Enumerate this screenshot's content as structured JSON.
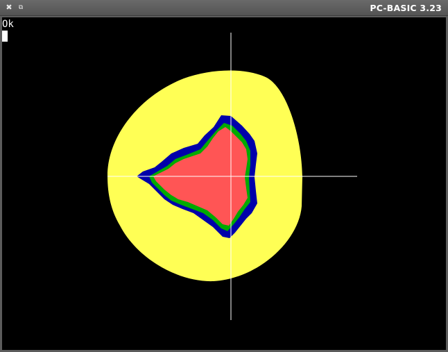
{
  "window": {
    "title": "PC-BASIC 3.23",
    "close_glyph": "✖",
    "restore_glyph": "⧉"
  },
  "screen": {
    "prompt": "Ok"
  },
  "colors": {
    "outer_ring": "#ffff55",
    "band_blue": "#0000aa",
    "band_green": "#00aa00",
    "set_red": "#ff5555",
    "axes": "#ffffff",
    "background": "#000000"
  }
}
